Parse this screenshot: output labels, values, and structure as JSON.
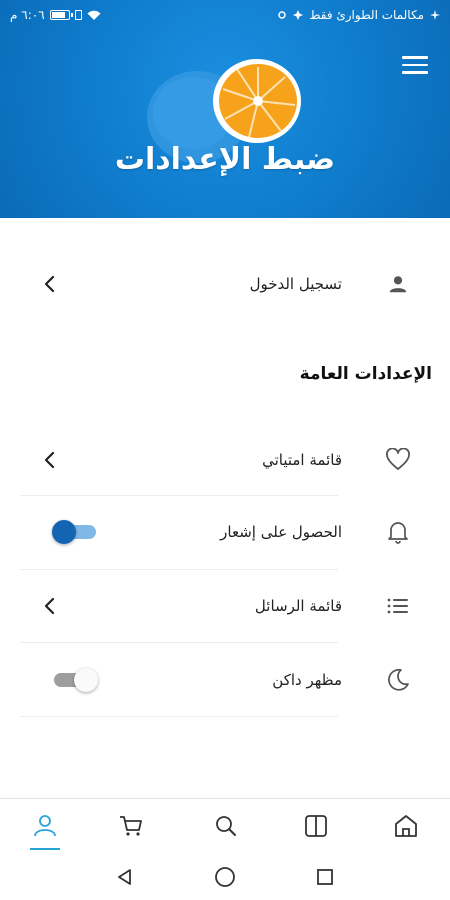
{
  "status_bar": {
    "time": "٦:٠٦ م",
    "carrier": "مكالمات الطوارئ فقط"
  },
  "header": {
    "title": "ضبط الإعدادات",
    "menu_icon": "hamburger-menu-icon"
  },
  "login_row": {
    "label": "تسجيل الدخول",
    "icon": "person-icon"
  },
  "general_settings": {
    "title": "الإعدادات العامة",
    "items": [
      {
        "label": "قائمة امتياتي",
        "icon": "heart-icon",
        "control": "chevron"
      },
      {
        "label": "الحصول على إشعار",
        "icon": "bell-icon",
        "control": "toggle",
        "enabled": true
      },
      {
        "label": "قائمة الرسائل",
        "icon": "list-icon",
        "control": "chevron"
      },
      {
        "label": "مظهر داكن",
        "icon": "moon-icon",
        "control": "toggle",
        "enabled": false
      }
    ]
  },
  "bottom_nav": {
    "items": [
      "profile-icon",
      "cart-icon",
      "search-icon",
      "book-icon",
      "home-icon"
    ],
    "active": "profile-icon"
  },
  "colors": {
    "header_bg": "#0f7bcb",
    "accent": "#2aa3d9",
    "toggle_on": "#1464b4"
  }
}
